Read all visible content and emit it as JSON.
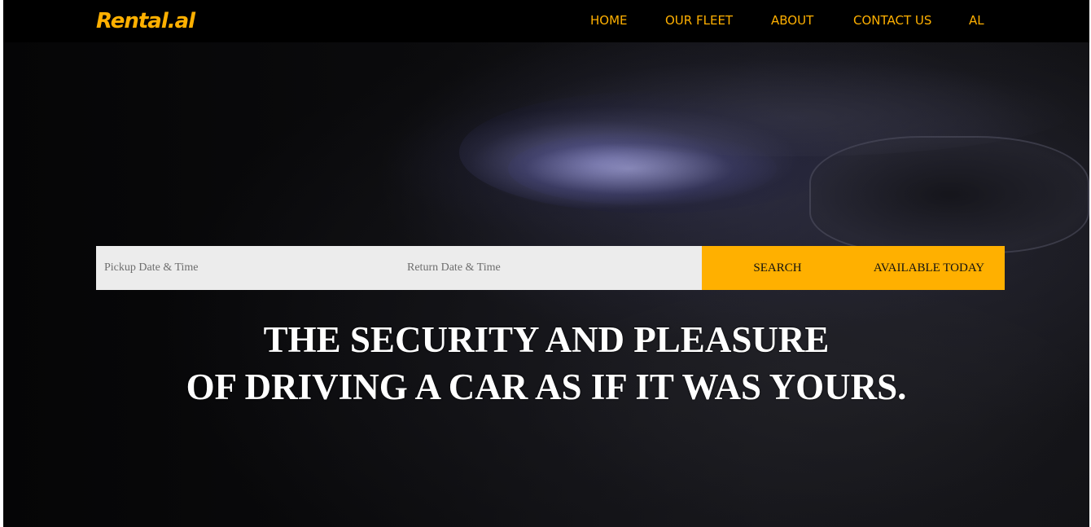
{
  "brand": {
    "logo_text": "Rental.al",
    "logo_color": "#ffb000"
  },
  "nav": {
    "items": [
      {
        "label": "HOME"
      },
      {
        "label": "OUR FLEET"
      },
      {
        "label": "ABOUT"
      },
      {
        "label": "CONTACT US"
      },
      {
        "label": "AL"
      }
    ],
    "link_color": "#ffb000"
  },
  "search": {
    "pickup_placeholder": "Pickup Date & Time",
    "return_placeholder": "Return Date & Time",
    "search_label": "SEARCH",
    "available_label": "AVAILABLE TODAY",
    "button_color": "#ffb000",
    "field_color": "#ececec"
  },
  "hero": {
    "line1": "THE SECURITY AND PLEASURE",
    "line2": "OF DRIVING A CAR AS IF IT WAS YOURS."
  }
}
